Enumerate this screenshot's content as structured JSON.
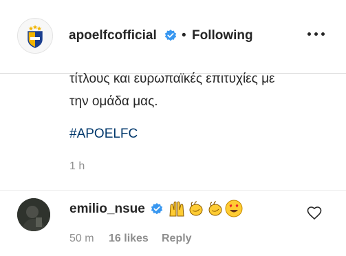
{
  "post": {
    "username": "apoelfcofficial",
    "dot": "•",
    "follow_label": "Following",
    "caption_lines": [
      "τίτλους και ευρωπαϊκές επιτυχίες με",
      "την ομάδα μας."
    ],
    "hashtag": "#APOELFC",
    "time": "1 h"
  },
  "comment": {
    "username": "emilio_nsue",
    "emojis": [
      "raising-hands",
      "clapping-hands",
      "clapping-hands",
      "heart-eyes"
    ],
    "time": "50 m",
    "likes": "16 likes",
    "reply_label": "Reply"
  },
  "colors": {
    "verified_blue": "#3897f0",
    "hashtag_blue": "#00376b",
    "muted_gray": "#8e8e8e",
    "emoji_yellow": "#ffcc33"
  }
}
